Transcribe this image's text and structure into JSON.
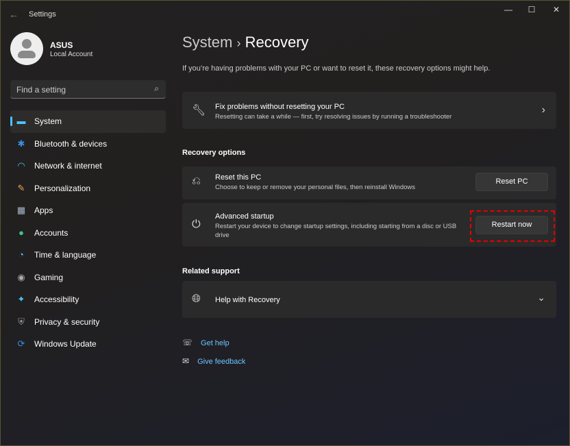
{
  "window": {
    "title": "Settings",
    "minimize": "—",
    "maximize": "☐",
    "close": "✕",
    "back": "←"
  },
  "profile": {
    "name": "ASUS",
    "account": "Local Account"
  },
  "search": {
    "placeholder": "Find a setting",
    "icon": "⌕"
  },
  "nav": [
    {
      "label": "System",
      "icon": "▬",
      "color": "#4cc2ff"
    },
    {
      "label": "Bluetooth & devices",
      "icon": "✱",
      "color": "#3a8ee6"
    },
    {
      "label": "Network & internet",
      "icon": "◠",
      "color": "#4cc2ff"
    },
    {
      "label": "Personalization",
      "icon": "✎",
      "color": "#e6a15a"
    },
    {
      "label": "Apps",
      "icon": "▦",
      "color": "#a8b8cc"
    },
    {
      "label": "Accounts",
      "icon": "●",
      "color": "#3cc29a"
    },
    {
      "label": "Time & language",
      "icon": "◔",
      "color": "#4cc2ff"
    },
    {
      "label": "Gaming",
      "icon": "◉",
      "color": "#aaaaaa"
    },
    {
      "label": "Accessibility",
      "icon": "✦",
      "color": "#4cc2ff"
    },
    {
      "label": "Privacy & security",
      "icon": "⛨",
      "color": "#9a9a9a"
    },
    {
      "label": "Windows Update",
      "icon": "⟳",
      "color": "#3a8ee6"
    }
  ],
  "header": {
    "parent": "System",
    "sep": "›",
    "title": "Recovery"
  },
  "description": "If you’re having problems with your PC or want to reset it, these recovery options might help.",
  "fix": {
    "title": "Fix problems without resetting your PC",
    "desc": "Resetting can take a while — first, try resolving issues by running a troubleshooter",
    "chevron": "›"
  },
  "recovery_options": {
    "heading": "Recovery options",
    "reset": {
      "title": "Reset this PC",
      "desc": "Choose to keep or remove your personal files, then reinstall Windows",
      "button": "Reset PC"
    },
    "advanced": {
      "title": "Advanced startup",
      "desc": "Restart your device to change startup settings, including starting from a disc or USB drive",
      "button": "Restart now"
    }
  },
  "related": {
    "heading": "Related support",
    "help": "Help with Recovery",
    "chevron": "⌄"
  },
  "links": {
    "get_help": "Get help",
    "feedback": "Give feedback"
  }
}
